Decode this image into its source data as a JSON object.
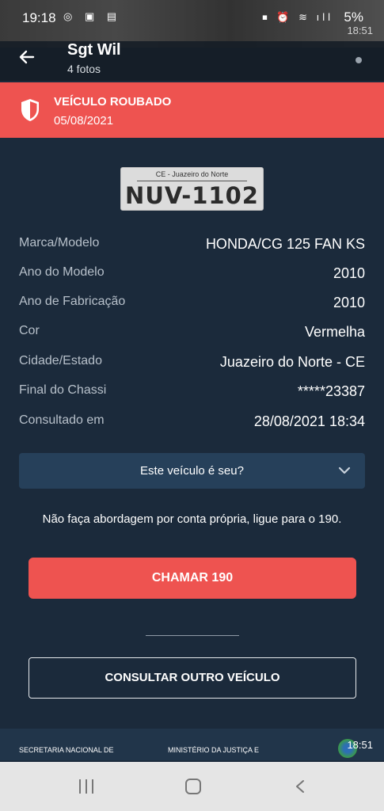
{
  "status_bar": {
    "time": "19:18",
    "left_icons": "◎ ▣ ▤",
    "right_icons": "⏹ ⏰ ≋ ıll",
    "battery": "5%",
    "overlay_time": "18:51"
  },
  "header": {
    "title": "Sgt Wil",
    "subtitle": "4 fotos"
  },
  "alert": {
    "title": "VEÍCULO ROUBADO",
    "date": "05/08/2021",
    "color": "#ee5350"
  },
  "plate": {
    "region": "CE - Juazeiro do Norte",
    "number": "NUV-1102"
  },
  "vehicle_info": [
    {
      "label": "Marca/Modelo",
      "value": "HONDA/CG 125 FAN KS"
    },
    {
      "label": "Ano do Modelo",
      "value": "2010"
    },
    {
      "label": "Ano de Fabricação",
      "value": "2010"
    },
    {
      "label": "Cor",
      "value": "Vermelha"
    },
    {
      "label": "Cidade/Estado",
      "value": "Juazeiro do Norte - CE"
    },
    {
      "label": "Final do Chassi",
      "value": "*****23387"
    },
    {
      "label": "Consultado em",
      "value": "28/08/2021 18:34"
    }
  ],
  "owner_dropdown": {
    "label": "Este veículo é seu?",
    "icon": "chevron-down-icon"
  },
  "warning": "Não faça abordagem por conta própria, ligue para o 190.",
  "call_button": "CHAMAR 190",
  "consult_button": "CONSULTAR OUTRO VEÍCULO",
  "footer": {
    "left": "SECRETARIA NACIONAL DE",
    "middle": "MINISTÉRIO DA JUSTIÇA E",
    "time": "18:51"
  },
  "colors": {
    "background": "#1b2a3b",
    "accent_red": "#ee5350",
    "dropdown_bg": "#26405a"
  }
}
